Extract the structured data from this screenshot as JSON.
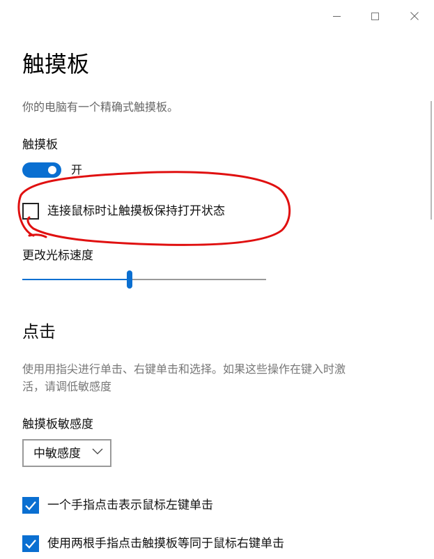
{
  "window": {
    "minimize_icon": "minimize-icon",
    "maximize_icon": "maximize-icon",
    "close_label": "✕"
  },
  "page": {
    "title": "触摸板",
    "description": "你的电脑有一个精确式触摸板。"
  },
  "touchpad": {
    "label": "触摸板",
    "toggle_on": true,
    "toggle_state_label": "开"
  },
  "keep_on_with_mouse": {
    "label": "连接鼠标时让触摸板保持打开状态",
    "checked": false
  },
  "cursor_speed": {
    "label": "更改光标速度",
    "value_fraction": 0.44
  },
  "taps": {
    "section_title": "点击",
    "description_line1": "使用用指尖进行单击、右键单击和选择。如果这些操作在键入时激",
    "description_line2": "活，请调低敏感度",
    "sensitivity_label": "触摸板敏感度",
    "sensitivity_value": "中敏感度",
    "options": [
      {
        "label": "一个手指点击表示鼠标左键单击",
        "checked": true
      },
      {
        "label": "使用两根手指点击触摸板等同于鼠标右键单击",
        "checked": true
      }
    ]
  },
  "colors": {
    "accent": "#0a6fd1",
    "annotation": "#e01010"
  }
}
